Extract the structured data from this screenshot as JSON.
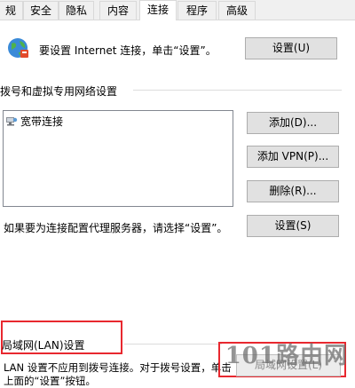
{
  "tabs": [
    {
      "label": "规"
    },
    {
      "label": "安全"
    },
    {
      "label": "隐私"
    },
    {
      "label": "内容"
    },
    {
      "label": "连接"
    },
    {
      "label": "程序"
    },
    {
      "label": "高级"
    }
  ],
  "internet": {
    "text": "要设置 Internet 连接，单击“设置”。",
    "button": "设置(U)"
  },
  "dialup": {
    "section_title": "拨号和虚拟专用网络设置",
    "items": [
      {
        "label": "宽带连接",
        "icon": "network-connection-icon"
      }
    ],
    "add_button": "添加(D)...",
    "add_vpn_button": "添加 VPN(P)...",
    "delete_button": "删除(R)...",
    "proxy_text": "如果要为连接配置代理服务器，请选择“设置”。",
    "settings_button": "设置(S)"
  },
  "lan": {
    "section_title": "局域网(LAN)设置",
    "description_line1": "LAN 设置不应用到拨号连接。对于拨号设置，单击",
    "description_line2": "上面的“设置”按钮。",
    "button": "局域网设置(L)"
  },
  "watermark": {
    "text": "101路由网"
  },
  "colors": {
    "highlight": "#e8282f"
  }
}
